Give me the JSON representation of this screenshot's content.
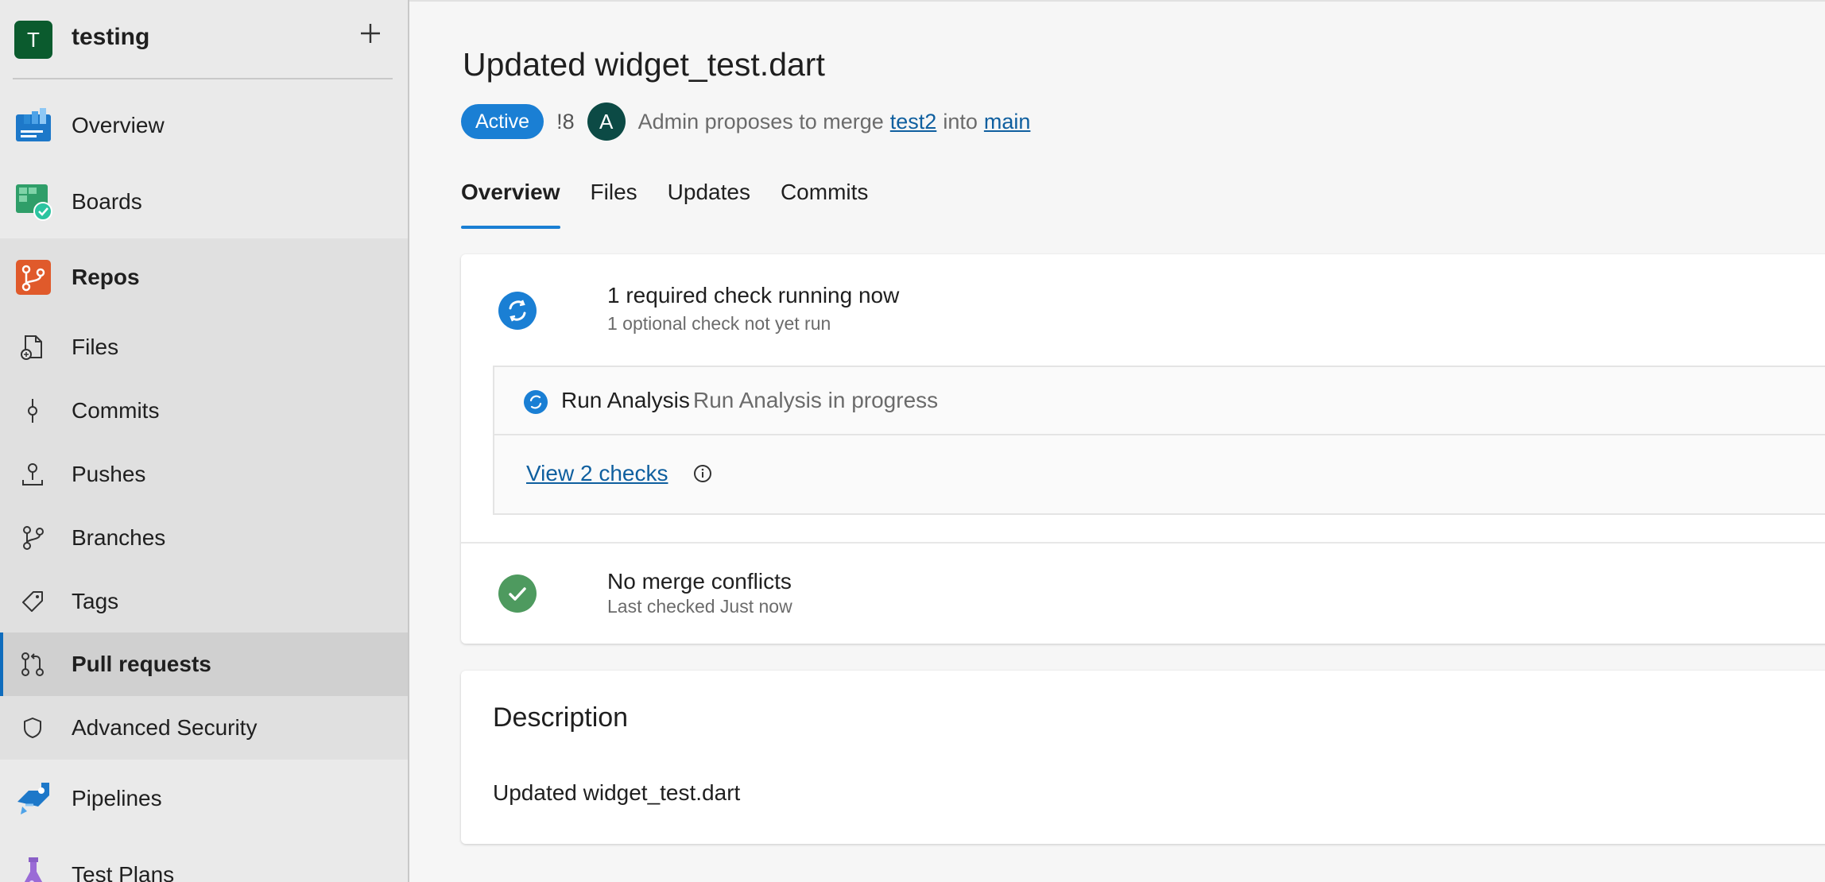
{
  "project": {
    "initial": "T",
    "name": "testing",
    "add_icon": "plus-icon"
  },
  "sidebar": {
    "items": [
      {
        "label": "Overview",
        "icon": "overview-icon"
      },
      {
        "label": "Boards",
        "icon": "boards-icon"
      },
      {
        "label": "Repos",
        "icon": "repos-icon"
      },
      {
        "label": "Files",
        "icon": "files-icon"
      },
      {
        "label": "Commits",
        "icon": "commit-icon"
      },
      {
        "label": "Pushes",
        "icon": "push-icon"
      },
      {
        "label": "Branches",
        "icon": "branch-icon"
      },
      {
        "label": "Tags",
        "icon": "tag-icon"
      },
      {
        "label": "Pull requests",
        "icon": "pull-request-icon",
        "selected": true
      },
      {
        "label": "Advanced Security",
        "icon": "shield-icon"
      },
      {
        "label": "Pipelines",
        "icon": "pipelines-icon"
      },
      {
        "label": "Test Plans",
        "icon": "test-plans-icon"
      }
    ]
  },
  "pr": {
    "title": "Updated widget_test.dart",
    "status": "Active",
    "id": "!8",
    "author_initial": "A",
    "author_text": "Admin proposes to merge",
    "source_branch": "test2",
    "into_text": "into",
    "target_branch": "main"
  },
  "tabs": [
    {
      "label": "Overview",
      "active": true
    },
    {
      "label": "Files"
    },
    {
      "label": "Updates"
    },
    {
      "label": "Commits"
    }
  ],
  "checks": {
    "title": "1 required check running now",
    "subtitle": "1 optional check not yet run",
    "run_name": "Run Analysis",
    "run_status": "Run Analysis in progress",
    "view_link": "View 2 checks"
  },
  "merge": {
    "title": "No merge conflicts",
    "subtitle": "Last checked Just now"
  },
  "description": {
    "title": "Description",
    "body": "Updated widget_test.dart"
  },
  "colors": {
    "accent": "#1a7fd4",
    "link": "#0f5f9f",
    "success": "#4e9a5f",
    "project_avatar": "#0b5b2e",
    "author_avatar": "#0c4a45"
  }
}
